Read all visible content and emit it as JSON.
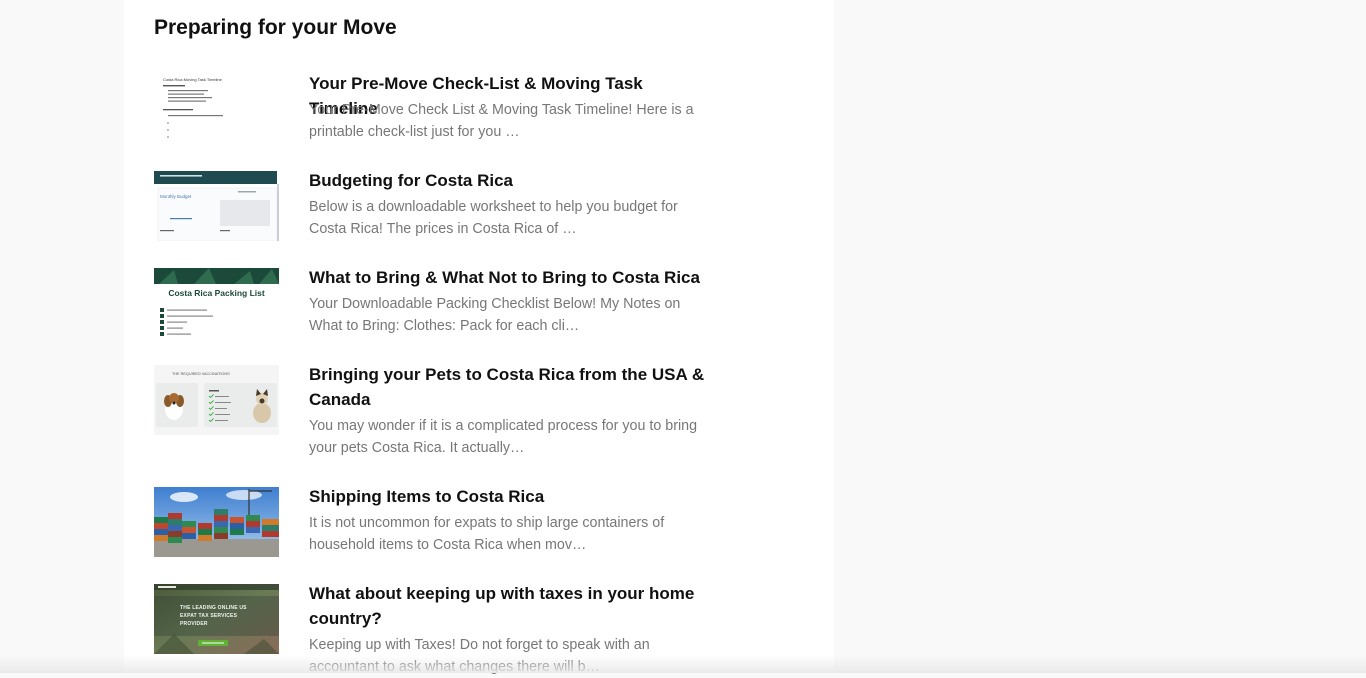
{
  "section": {
    "title": "Preparing for your Move"
  },
  "posts": [
    {
      "title": "Your Pre-Move Check-List & Moving Task Timeline",
      "excerpt": "Your Pre-Move Check List & Moving Task Timeline! Here is a printable check-list just for you …",
      "thumb_text": "Costa Rica Moving Task Timeline"
    },
    {
      "title": "Budgeting for Costa Rica",
      "excerpt": "Below is a downloadable worksheet to help you budget for Costa Rica! The prices in Costa Rica of …",
      "thumb_text": "Monthly Budget"
    },
    {
      "title": "What to Bring & What Not to Bring to Costa Rica",
      "excerpt": "Your Downloadable Packing Checklist Below! My Notes on What to Bring: Clothes: Pack for each cli…",
      "thumb_text": "Costa Rica Packing List"
    },
    {
      "title": "Bringing your Pets to Costa Rica from the USA & Canada",
      "excerpt": "You may wonder if it is a complicated process for you to bring your pets Costa Rica. It actually…",
      "thumb_text": "THE REQUIRED VACCINATIONS"
    },
    {
      "title": "Shipping Items to Costa Rica",
      "excerpt": "It is not uncommon for expats to ship large containers of household items to Costa Rica when mov…",
      "thumb_text": ""
    },
    {
      "title": "What about keeping up with taxes in your home country?",
      "excerpt": "Keeping up with Taxes! Do not forget to speak with an accountant to ask what changes there will b…",
      "thumb_text": "THE LEADING ONLINE US EXPAT TAX SERVICES PROVIDER"
    }
  ],
  "colors": {
    "background": "#f9f9f9",
    "panel": "#ffffff",
    "title": "#111111",
    "excerpt": "#777777",
    "budget_header": "#1f4a4f",
    "packing_header": "#1b4a3a"
  }
}
